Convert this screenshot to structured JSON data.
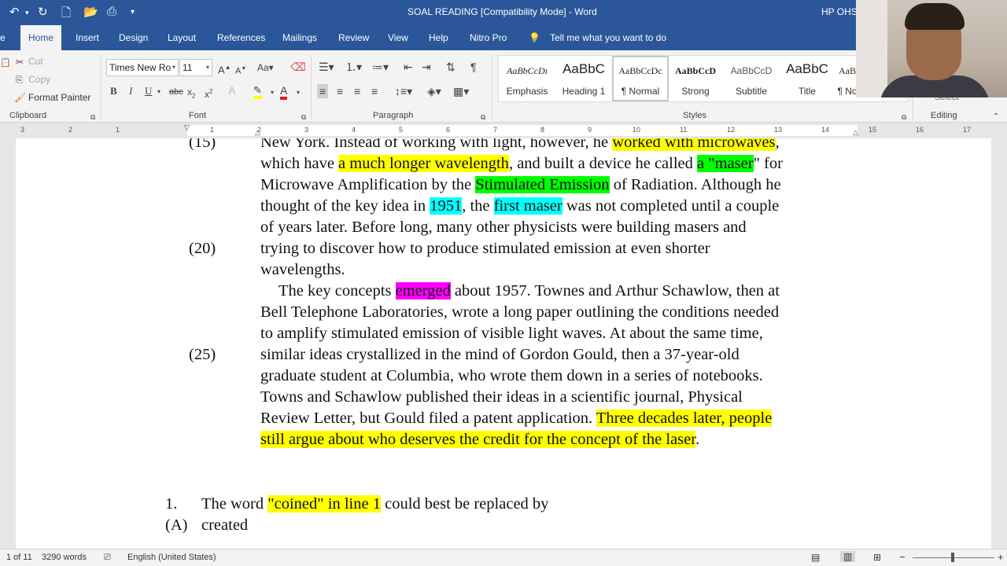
{
  "titlebar": {
    "title": "SOAL READING [Compatibility Mode] - Word",
    "user": "HP OHS"
  },
  "tabs": [
    {
      "label": "e",
      "active": false
    },
    {
      "label": "Home",
      "active": true
    },
    {
      "label": "Insert",
      "active": false
    },
    {
      "label": "Design",
      "active": false
    },
    {
      "label": "Layout",
      "active": false
    },
    {
      "label": "References",
      "active": false
    },
    {
      "label": "Mailings",
      "active": false
    },
    {
      "label": "Review",
      "active": false
    },
    {
      "label": "View",
      "active": false
    },
    {
      "label": "Help",
      "active": false
    },
    {
      "label": "Nitro Pro",
      "active": false
    }
  ],
  "tell_me": "Tell me what you want to do",
  "clipboard": {
    "cut": "Cut",
    "copy": "Copy",
    "format_painter": "Format Painter",
    "label": "Clipboard"
  },
  "font": {
    "name": "Times New Ro",
    "size": "11",
    "label": "Font"
  },
  "paragraph": {
    "label": "Paragraph"
  },
  "styles": {
    "label": "Styles",
    "items": [
      {
        "preview": "AaBbCcDı",
        "name": "Emphasis"
      },
      {
        "preview": "AaBbC",
        "name": "Heading 1"
      },
      {
        "preview": "AaBbCcDc",
        "name": "¶ Normal"
      },
      {
        "preview": "AaBbCcD",
        "name": "Strong"
      },
      {
        "preview": "AaBbCcD",
        "name": "Subtitle"
      },
      {
        "preview": "AaBbC",
        "name": "Title"
      },
      {
        "preview": "AaB",
        "name": "¶ No"
      }
    ]
  },
  "editing": {
    "label": "Editing",
    "select": "Select"
  },
  "ruler": [
    "3",
    "2",
    "1",
    "1",
    "2",
    "3",
    "4",
    "5",
    "6",
    "7",
    "8",
    "9",
    "10",
    "11",
    "12",
    "13",
    "14",
    "15",
    "16",
    "17"
  ],
  "document": {
    "line_numbers": {
      "n15": "(15)",
      "n20": "(20)",
      "n25": "(25)"
    },
    "l1": {
      "a": "New York. Instead of working with light, however, he ",
      "b": "worked with microwaves",
      "c": ","
    },
    "l2": {
      "a": "which have ",
      "b": "a much longer wavelength",
      "c": ", and built a device he called ",
      "d": "a \"maser",
      "e": "\" for"
    },
    "l3": {
      "a": "Microwave Amplification by the ",
      "b": "Stimulated Emission",
      "c": " of Radiation. Although he"
    },
    "l4": {
      "a": "thought of the key idea in ",
      "b": "1951",
      "c": ", the ",
      "d": "first maser",
      "e": " was not completed until a couple"
    },
    "l5": "of years later. Before long, many other physicists were building masers and",
    "l6": "trying to discover how to produce stimulated emission at even shorter",
    "l7": "wavelengths.",
    "l8": {
      "a": "The key concepts ",
      "b": "emerged",
      "c": " about 1957. Townes and Arthur Schawlow, then at"
    },
    "l9": "Bell Telephone Laboratories, wrote a long paper outlining the conditions needed",
    "l10": "to amplify stimulated emission of visible light waves. At about the same time,",
    "l11": "similar ideas crystallized in the mind of Gordon Gould, then a 37-year-old",
    "l12": "graduate student at Columbia, who wrote them down in a series of notebooks.",
    "l13": "Towns and Schawlow published their ideas in a scientific journal, Physical",
    "l14": {
      "a": "Review Letter, but Gould filed a patent application. ",
      "b": "Three decades later, people"
    },
    "l15": {
      "b": "still argue about who deserves the credit for the concept of the laser",
      "c": "."
    },
    "q1": {
      "num": "1.",
      "a": "The word ",
      "b": "\"coined\" in line 1",
      "c": " could best be replaced by"
    },
    "q1a": {
      "num": "(A)",
      "text": "created"
    }
  },
  "status": {
    "page": "1 of 11",
    "words": "3290 words",
    "language": "English (United States)"
  }
}
